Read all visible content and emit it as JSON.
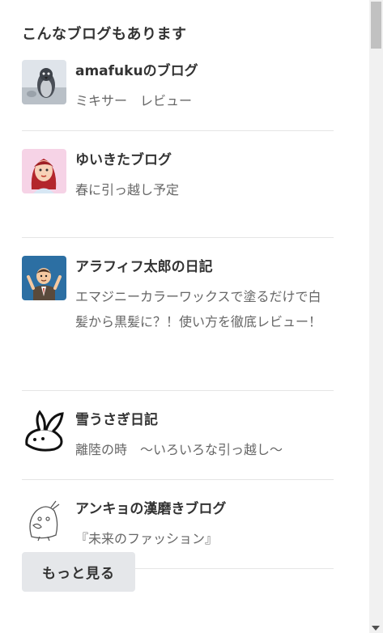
{
  "section": {
    "heading": "こんなブログもあります"
  },
  "blogs": [
    {
      "title": "amafukuのブログ",
      "description": "ミキサー　レビュー",
      "icon": "penguin-icon"
    },
    {
      "title": "ゆいきたブログ",
      "description": "春に引っ越し予定",
      "icon": "girl-avatar-icon"
    },
    {
      "title": "アラフィフ太郎の日記",
      "description": "エマジニーカラーワックスで塗るだけで白髪から黒髪に？！使い方を徹底レビュー！",
      "icon": "businessman-avatar-icon"
    },
    {
      "title": "雪うさぎ日記",
      "description": "離陸の時　～いろいろな引っ越し～",
      "icon": "snow-rabbit-icon"
    },
    {
      "title": "アンキョの漢磨きブログ",
      "description": "『未来のファッション』",
      "icon": "bird-sketch-icon"
    }
  ],
  "more_button": {
    "label": "もっと見る"
  }
}
